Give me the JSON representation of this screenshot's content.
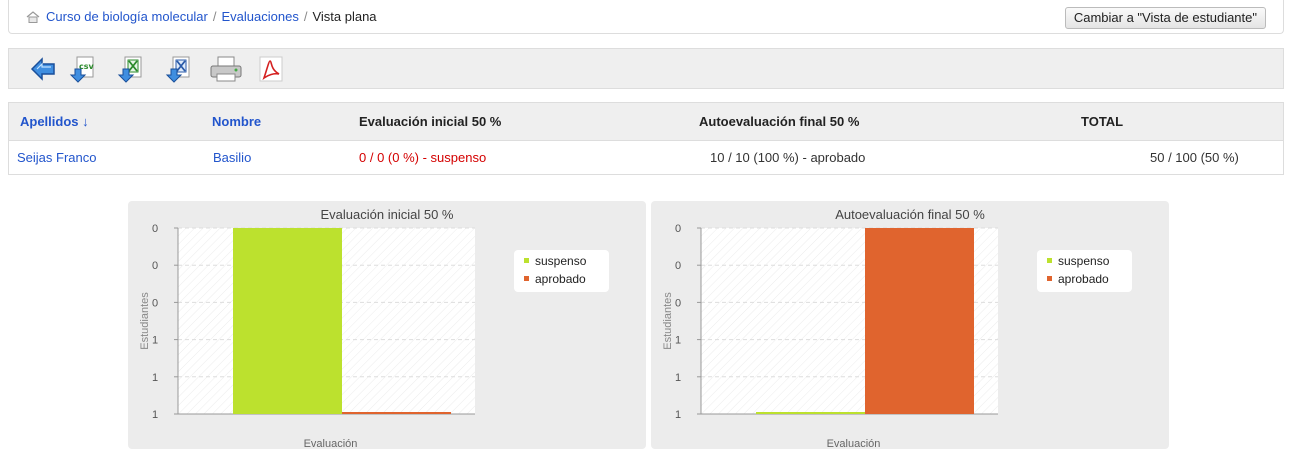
{
  "breadcrumb": {
    "items": [
      "Curso de biología molecular",
      "Evaluaciones",
      "Vista plana"
    ],
    "separator": "/"
  },
  "switch_view_button": "Cambiar a \"Vista de estudiante\"",
  "toolbar": {
    "icons": [
      "back-arrow-icon",
      "export-csv-icon",
      "export-excel-icon",
      "export-xml-icon",
      "print-icon",
      "export-pdf-icon"
    ],
    "csv_text": "csv"
  },
  "table": {
    "headers": {
      "surname": "Apellidos ↓",
      "name": "Nombre",
      "eval1": "Evaluación inicial 50 %",
      "eval2": "Autoevaluación final 50 %",
      "total": "TOTAL"
    },
    "rows": [
      {
        "surname": "Seijas Franco",
        "name": "Basilio",
        "eval1": "0 / 0 (0 %) - suspenso",
        "eval2": "10 / 10 (100 %) - aprobado",
        "total": "50 / 100 (50 %)"
      }
    ]
  },
  "colors": {
    "suspenso": "#bce12e",
    "aprobado": "#e0642e",
    "link": "#2255cc",
    "fail": "#d40000"
  },
  "chart_data": [
    {
      "type": "bar",
      "title": "Evaluación inicial 50 %",
      "xlabel": "Evaluación",
      "ylabel": "Estudiantes",
      "ytick_labels": [
        "1",
        "1",
        "1",
        "0",
        "0",
        "0"
      ],
      "ylim": [
        0,
        1
      ],
      "grid": true,
      "legend": "right",
      "series": [
        {
          "name": "suspenso",
          "values": [
            1
          ]
        },
        {
          "name": "aprobado",
          "values": [
            0
          ]
        }
      ]
    },
    {
      "type": "bar",
      "title": "Autoevaluación final 50 %",
      "xlabel": "Evaluación",
      "ylabel": "Estudiantes",
      "ytick_labels": [
        "1",
        "1",
        "1",
        "0",
        "0",
        "0"
      ],
      "ylim": [
        0,
        1
      ],
      "grid": true,
      "legend": "right",
      "series": [
        {
          "name": "suspenso",
          "values": [
            0
          ]
        },
        {
          "name": "aprobado",
          "values": [
            1
          ]
        }
      ]
    }
  ]
}
